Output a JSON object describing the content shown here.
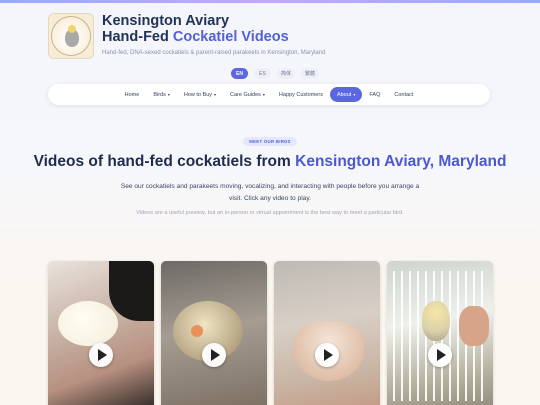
{
  "header": {
    "title_line1": "Kensington Aviary",
    "title_line2_plain": "Hand-Fed ",
    "title_line2_accent": "Cockatiel Videos",
    "subtitle": "Hand-fed, DNA-sexed cockatiels & parent-raised parakeets in Kensington, Maryland",
    "logo_text": "KENSINGTON AVIARY"
  },
  "languages": [
    {
      "label": "EN",
      "active": true
    },
    {
      "label": "ES",
      "active": false
    },
    {
      "label": "简体",
      "active": false
    },
    {
      "label": "繁體",
      "active": false
    }
  ],
  "nav": [
    {
      "label": "Home",
      "dropdown": false,
      "active": false
    },
    {
      "label": "Birds",
      "dropdown": true,
      "active": false
    },
    {
      "label": "How to Buy",
      "dropdown": true,
      "active": false
    },
    {
      "label": "Care Guides",
      "dropdown": true,
      "active": false
    },
    {
      "label": "Happy Customers",
      "dropdown": false,
      "active": false
    },
    {
      "label": "About",
      "dropdown": true,
      "active": true
    },
    {
      "label": "FAQ",
      "dropdown": false,
      "active": false
    },
    {
      "label": "Contact",
      "dropdown": false,
      "active": false
    }
  ],
  "hero": {
    "badge": "MEET OUR BIRDS",
    "headline_plain": "Videos of hand-fed cockatiels from ",
    "headline_accent": "Kensington Aviary, Maryland",
    "intro": "See our cockatiels and parakeets moving, vocalizing, and interacting with people before you arrange a visit. Click any video to play.",
    "note": "Videos are a useful preview, but an in-person or virtual appointment is the best way to meet a particular bird."
  },
  "videos": [
    {
      "name": "video-1",
      "icon": "play-icon"
    },
    {
      "name": "video-2",
      "icon": "play-icon"
    },
    {
      "name": "video-3",
      "icon": "play-icon"
    },
    {
      "name": "video-4",
      "icon": "play-icon"
    }
  ],
  "colors": {
    "accent": "#5b67e0",
    "headline": "#1f2d4d",
    "headline_accent": "#4a58d4"
  }
}
